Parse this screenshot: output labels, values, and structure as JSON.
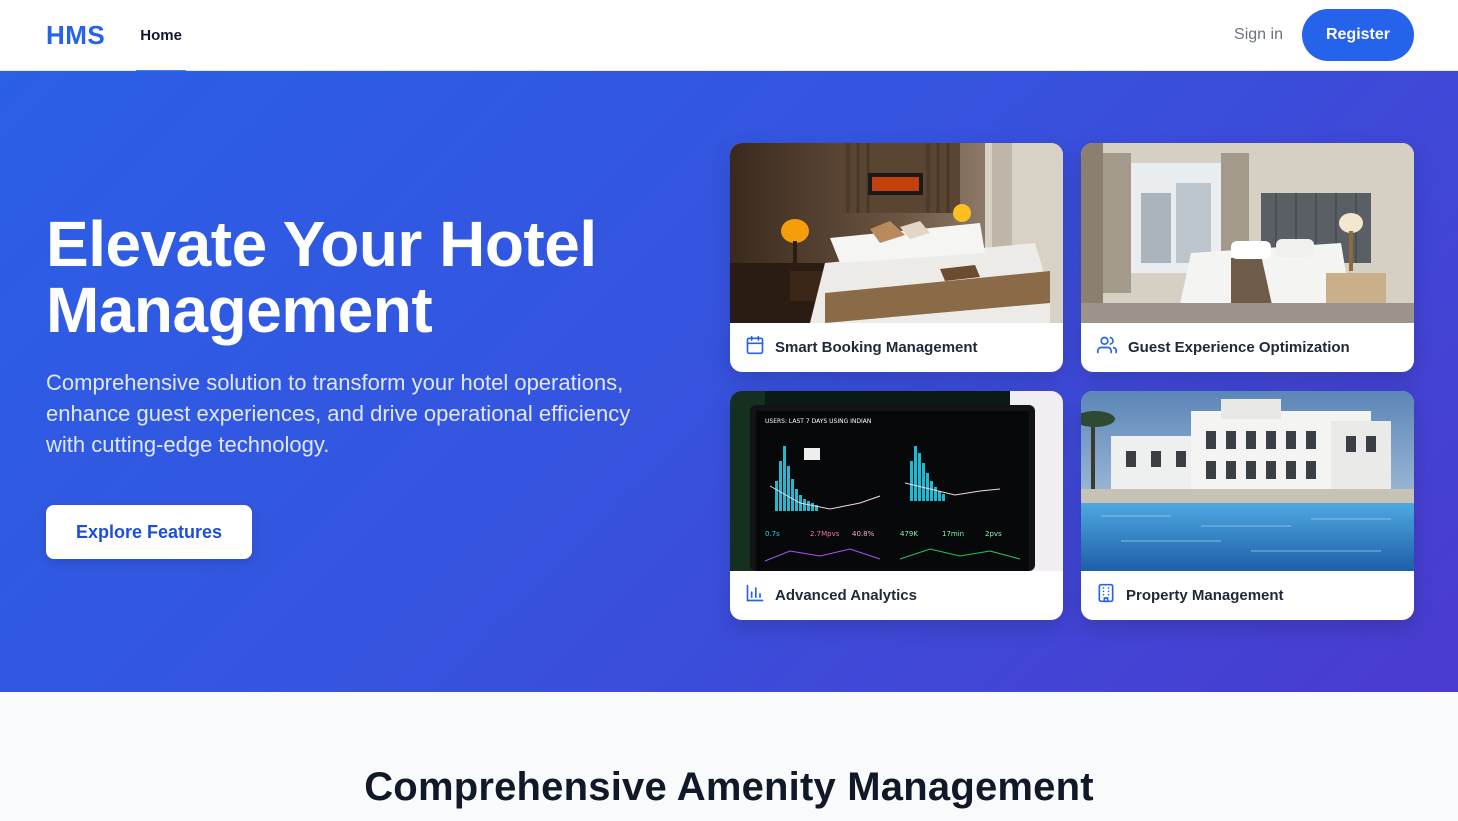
{
  "nav": {
    "logo": "HMS",
    "links": [
      {
        "label": "Home",
        "active": true
      }
    ],
    "signin_label": "Sign in",
    "register_label": "Register"
  },
  "hero": {
    "title": "Elevate Your Hotel Management",
    "subtitle": "Comprehensive solution to transform your hotel operations, enhance guest experiences, and drive operational efficiency with cutting-edge technology.",
    "cta_label": "Explore Features"
  },
  "cards": [
    {
      "label": "Smart Booking Management",
      "icon": "calendar-icon",
      "image": "hotel-bedroom-photo"
    },
    {
      "label": "Guest Experience Optimization",
      "icon": "users-icon",
      "image": "hotel-room-photo"
    },
    {
      "label": "Advanced Analytics",
      "icon": "bar-chart-icon",
      "image": "analytics-dashboard-photo"
    },
    {
      "label": "Property Management",
      "icon": "building-icon",
      "image": "resort-pool-photo"
    }
  ],
  "section": {
    "title": "Comprehensive Amenity Management"
  },
  "colors": {
    "brand": "#2563eb",
    "hero_gradient_start": "#2b5fe6",
    "hero_gradient_end": "#4a3bcf",
    "icon": "#2563eb"
  }
}
